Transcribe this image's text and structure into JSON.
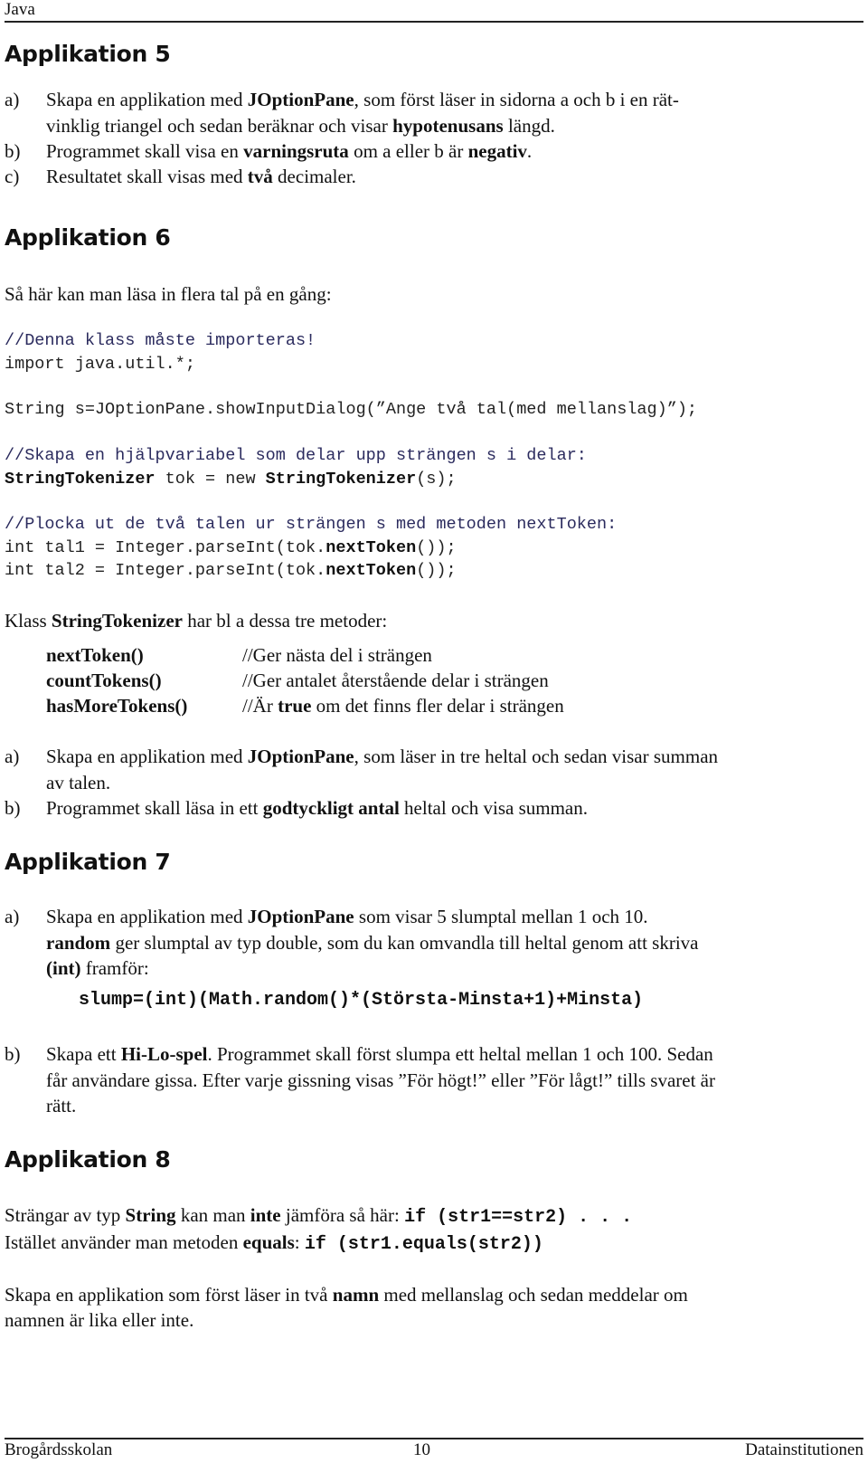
{
  "page_header": {
    "title": "Java"
  },
  "app5": {
    "heading": "Applikation 5",
    "items": [
      {
        "label": "a)",
        "line1": [
          "Skapa en applikation med ",
          "JOptionPane",
          ", som först läser in sidorna a och b i en rät-"
        ],
        "line2": [
          "vinklig triangel och sedan beräknar och visar ",
          "hypotenusans",
          " längd."
        ]
      },
      {
        "label": "b)",
        "line1": [
          "Programmet skall visa en ",
          "varningsruta",
          "  om a eller b är ",
          "negativ",
          "."
        ]
      },
      {
        "label": "c)",
        "line1": [
          "Resultatet skall visas med ",
          "två",
          " decimaler."
        ]
      }
    ]
  },
  "app6": {
    "heading": "Applikation 6",
    "intro": "Så här kan man läsa in flera tal på en gång:",
    "code": {
      "comment1": "//Denna klass måste importeras!",
      "import": "import java.util.*;",
      "input_line": "String s=JOptionPane.showInputDialog(”Ange två tal(med mellanslag)”);",
      "comment2": "//Skapa en hjälpvariabel som delar upp strängen s i delar:",
      "tok_class": "StringTokenizer",
      "tok_mid": " tok = new ",
      "tok_end": "(s);",
      "comment3": "//Plocka ut de två talen ur strängen s med metoden nextToken:",
      "tal1_start": "int tal1 = Integer.parseInt(tok.",
      "tal2_start": "int tal2 = Integer.parseInt(tok.",
      "next_token": "nextToken",
      "tal_end": "());"
    },
    "methods_intro": [
      "Klass ",
      "StringTokenizer",
      " har bl a dessa tre metoder:"
    ],
    "methods": [
      {
        "name": "nextToken()",
        "desc_pre": "//Ger nästa del i strängen",
        "desc_bold": "",
        "desc_post": ""
      },
      {
        "name": "countTokens()",
        "desc_pre": "//Ger antalet återstående delar i strängen",
        "desc_bold": "",
        "desc_post": ""
      },
      {
        "name": "hasMoreTokens()",
        "desc_pre": "//Är ",
        "desc_bold": "true",
        "desc_post": " om det finns fler delar i strängen"
      }
    ],
    "items": [
      {
        "label": "a)",
        "line1": [
          "Skapa en applikation med ",
          "JOptionPane",
          ", som läser in tre heltal och sedan visar summan"
        ],
        "line2": "av talen."
      },
      {
        "label": "b)",
        "line1": [
          "Programmet skall läsa in ett ",
          "godtyckligt antal",
          " heltal och visa summan."
        ]
      }
    ]
  },
  "app7": {
    "heading": "Applikation 7",
    "items": [
      {
        "label": "a)",
        "line1": [
          "Skapa en applikation med ",
          "JOptionPane",
          " som visar 5 slumptal mellan 1 och 10."
        ],
        "line2": [
          "random",
          " ger slumptal av typ double, som du kan omvandla till heltal genom att skriva"
        ],
        "line3": [
          "(int)",
          " framför:"
        ]
      },
      {
        "label": "b)",
        "line1": [
          "Skapa ett ",
          "Hi-Lo-spel",
          ". Programmet skall först slumpa ett heltal mellan 1 och 100. Sedan"
        ],
        "line2": "får användare gissa. Efter varje gissning visas ”För högt!” eller ”För lågt!” tills svaret är",
        "line3": "rätt."
      }
    ],
    "formula": "slump=(int)(Math.random()*(Största-Minsta+1)+Minsta)"
  },
  "app8": {
    "heading": "Applikation 8",
    "line1": [
      "Strängar av typ ",
      "String",
      " kan  man ",
      "inte",
      " jämföra så här: "
    ],
    "line1_code": "if (str1==str2) . . .",
    "line2": [
      "Istället använder man metoden ",
      "equals",
      ": "
    ],
    "line2_code": "if (str1.equals(str2))",
    "task_line1": [
      "Skapa en applikation som först läser in två ",
      "namn",
      " med mellanslag och sedan meddelar om"
    ],
    "task_line2": "namnen är lika eller inte."
  },
  "footer": {
    "left": "Brogårdsskolan",
    "page_number": "10",
    "right": "Datainstitutionen"
  }
}
